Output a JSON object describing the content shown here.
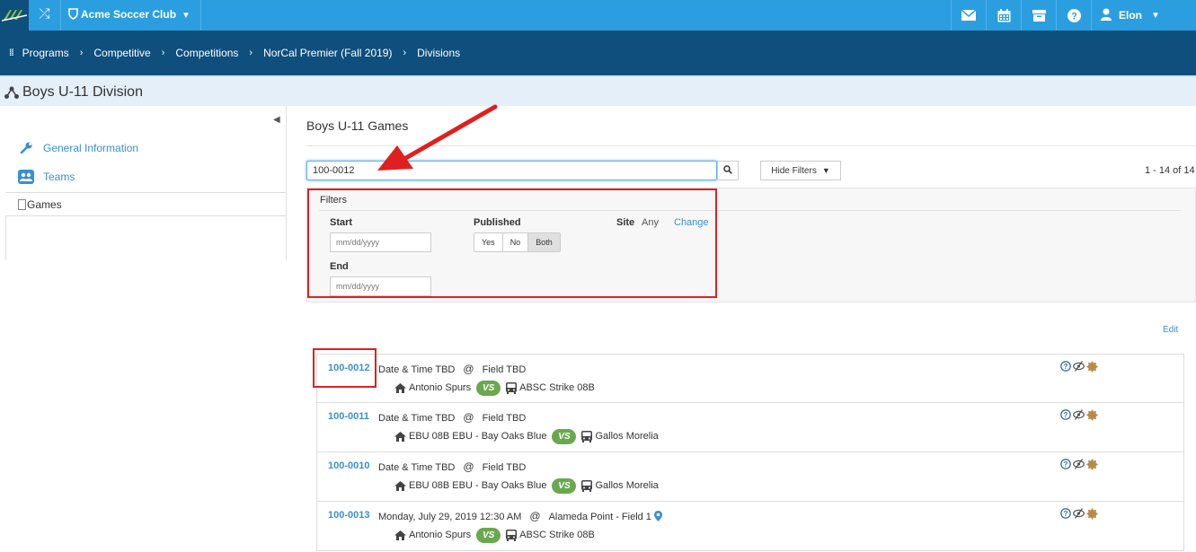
{
  "topbar": {
    "club_name": "Acme Soccer Club",
    "user_name": "Elon",
    "icons": [
      "envelope-icon",
      "calendar-icon",
      "archive-icon",
      "help-icon",
      "user-icon"
    ]
  },
  "breadcrumb": [
    "Programs",
    "Competitive",
    "Competitions",
    "NorCal Premier (Fall 2019)",
    "Divisions"
  ],
  "page_title": "Boys U-11 Division",
  "sidebar": {
    "items": [
      {
        "label": "General Information",
        "icon": "wrench-icon"
      },
      {
        "label": "Teams",
        "icon": "teams-icon"
      },
      {
        "label": "Games",
        "icon": "games-icon",
        "active": true
      }
    ]
  },
  "main": {
    "title": "Boys U-11 Games",
    "search_value": "100-0012",
    "hide_filters_label": "Hide Filters",
    "count_text": "1 - 14 of 14",
    "edit_label": "Edit"
  },
  "filters": {
    "title": "Filters",
    "start_label": "Start",
    "end_label": "End",
    "date_placeholder": "mm/dd/yyyy",
    "published_label": "Published",
    "published_options": [
      "Yes",
      "No",
      "Both"
    ],
    "published_selected": "Both",
    "site_label": "Site",
    "site_value": "Any",
    "change_label": "Change"
  },
  "games": [
    {
      "id": "100-0012",
      "when": "Date & Time TBD",
      "at": "@",
      "field": "Field TBD",
      "home": "Antonio Spurs",
      "vs": "VS",
      "away": "ABSC Strike 08B",
      "has_pin": false
    },
    {
      "id": "100-0011",
      "when": "Date & Time TBD",
      "at": "@",
      "field": "Field TBD",
      "home": "EBU 08B EBU - Bay Oaks Blue",
      "vs": "VS",
      "away": "Gallos Morelia",
      "has_pin": false
    },
    {
      "id": "100-0010",
      "when": "Date & Time TBD",
      "at": "@",
      "field": "Field TBD",
      "home": "EBU 08B EBU - Bay Oaks Blue",
      "vs": "VS",
      "away": "Gallos Morelia",
      "has_pin": false
    },
    {
      "id": "100-0013",
      "when": "Monday, July 29, 2019 12:30 AM",
      "at": "@",
      "field": "Alameda Point - Field 1",
      "home": "Antonio Spurs",
      "vs": "VS",
      "away": "ABSC Strike 08B",
      "has_pin": true
    }
  ],
  "colors": {
    "topbar": "#2b9ee0",
    "crumbbar": "#0f4f7d",
    "link": "#3a8fd0",
    "vs_badge": "#6aa84f",
    "annotation": "#e02020"
  }
}
